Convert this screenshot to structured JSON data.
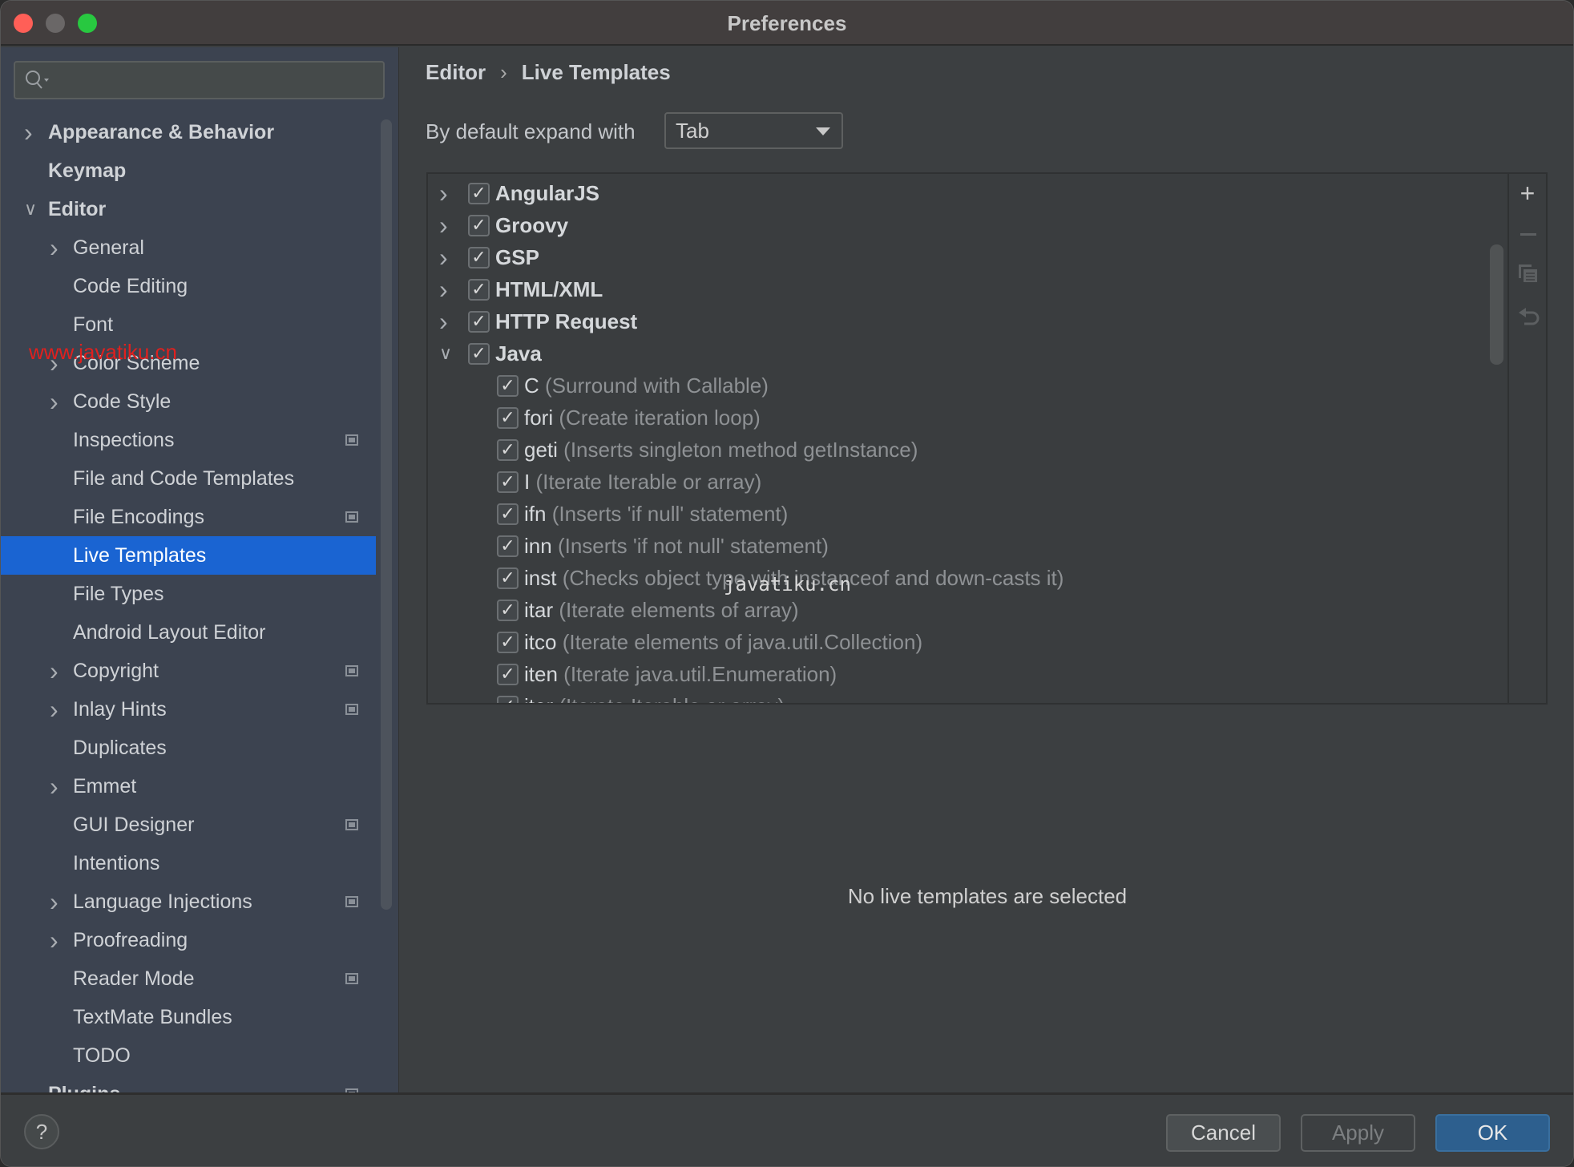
{
  "window": {
    "title": "Preferences",
    "traffic_lights": {
      "close": "#ff5f57",
      "minimize": "#6a6767",
      "zoom": "#28c840"
    }
  },
  "sidebar": {
    "search_placeholder": "",
    "items": [
      {
        "label": "Appearance & Behavior",
        "level": 0,
        "chevron": "right",
        "badge": false
      },
      {
        "label": "Keymap",
        "level": 0,
        "chevron": "none",
        "badge": false
      },
      {
        "label": "Editor",
        "level": 0,
        "chevron": "down",
        "badge": false
      },
      {
        "label": "General",
        "level": 1,
        "chevron": "right",
        "badge": false
      },
      {
        "label": "Code Editing",
        "level": 1,
        "chevron": "none",
        "badge": false
      },
      {
        "label": "Font",
        "level": 1,
        "chevron": "none",
        "badge": false
      },
      {
        "label": "Color Scheme",
        "level": 1,
        "chevron": "right",
        "badge": false
      },
      {
        "label": "Code Style",
        "level": 1,
        "chevron": "right",
        "badge": false
      },
      {
        "label": "Inspections",
        "level": 1,
        "chevron": "none",
        "badge": true
      },
      {
        "label": "File and Code Templates",
        "level": 1,
        "chevron": "none",
        "badge": false
      },
      {
        "label": "File Encodings",
        "level": 1,
        "chevron": "none",
        "badge": true
      },
      {
        "label": "Live Templates",
        "level": 1,
        "chevron": "none",
        "badge": false,
        "selected": true
      },
      {
        "label": "File Types",
        "level": 1,
        "chevron": "none",
        "badge": false
      },
      {
        "label": "Android Layout Editor",
        "level": 1,
        "chevron": "none",
        "badge": false
      },
      {
        "label": "Copyright",
        "level": 1,
        "chevron": "right",
        "badge": true
      },
      {
        "label": "Inlay Hints",
        "level": 1,
        "chevron": "right",
        "badge": true
      },
      {
        "label": "Duplicates",
        "level": 1,
        "chevron": "none",
        "badge": false
      },
      {
        "label": "Emmet",
        "level": 1,
        "chevron": "right",
        "badge": false
      },
      {
        "label": "GUI Designer",
        "level": 1,
        "chevron": "none",
        "badge": true
      },
      {
        "label": "Intentions",
        "level": 1,
        "chevron": "none",
        "badge": false
      },
      {
        "label": "Language Injections",
        "level": 1,
        "chevron": "right",
        "badge": true
      },
      {
        "label": "Proofreading",
        "level": 1,
        "chevron": "right",
        "badge": false
      },
      {
        "label": "Reader Mode",
        "level": 1,
        "chevron": "none",
        "badge": true
      },
      {
        "label": "TextMate Bundles",
        "level": 1,
        "chevron": "none",
        "badge": false
      },
      {
        "label": "TODO",
        "level": 1,
        "chevron": "none",
        "badge": false
      },
      {
        "label": "Plugins",
        "level": 0,
        "chevron": "none",
        "badge": true
      }
    ]
  },
  "main": {
    "breadcrumb": [
      "Editor",
      "Live Templates"
    ],
    "breadcrumb_sep": "›",
    "expand_label": "By default expand with",
    "expand_value": "Tab",
    "groups": [
      {
        "name": "AngularJS",
        "checked": true,
        "expanded": false
      },
      {
        "name": "Groovy",
        "checked": true,
        "expanded": false
      },
      {
        "name": "GSP",
        "checked": true,
        "expanded": false
      },
      {
        "name": "HTML/XML",
        "checked": true,
        "expanded": false
      },
      {
        "name": "HTTP Request",
        "checked": true,
        "expanded": false
      },
      {
        "name": "Java",
        "checked": true,
        "expanded": true,
        "templates": [
          {
            "abbr": "C",
            "desc": "(Surround with Callable)",
            "checked": true
          },
          {
            "abbr": "fori",
            "desc": "(Create iteration loop)",
            "checked": true
          },
          {
            "abbr": "geti",
            "desc": "(Inserts singleton method getInstance)",
            "checked": true
          },
          {
            "abbr": "I",
            "desc": "(Iterate Iterable or array)",
            "checked": true
          },
          {
            "abbr": "ifn",
            "desc": "(Inserts 'if null' statement)",
            "checked": true
          },
          {
            "abbr": "inn",
            "desc": "(Inserts 'if not null' statement)",
            "checked": true
          },
          {
            "abbr": "inst",
            "desc": "(Checks object type with instanceof and down-casts it)",
            "checked": true
          },
          {
            "abbr": "itar",
            "desc": "(Iterate elements of array)",
            "checked": true
          },
          {
            "abbr": "itco",
            "desc": "(Iterate elements of java.util.Collection)",
            "checked": true
          },
          {
            "abbr": "iten",
            "desc": "(Iterate java.util.Enumeration)",
            "checked": true
          },
          {
            "abbr": "iter",
            "desc": "(Iterate Iterable or array)",
            "checked": true
          }
        ]
      }
    ],
    "toolbar_icons": [
      "plus-icon",
      "minus-icon",
      "copy-icon",
      "undo-icon"
    ],
    "empty_message": "No live templates are selected"
  },
  "footer": {
    "help": "?",
    "cancel": "Cancel",
    "apply": "Apply",
    "ok": "OK",
    "ok_color": "#2d5f8e"
  },
  "watermarks": [
    "www.javatiku.cn",
    "javatiku.cn"
  ]
}
